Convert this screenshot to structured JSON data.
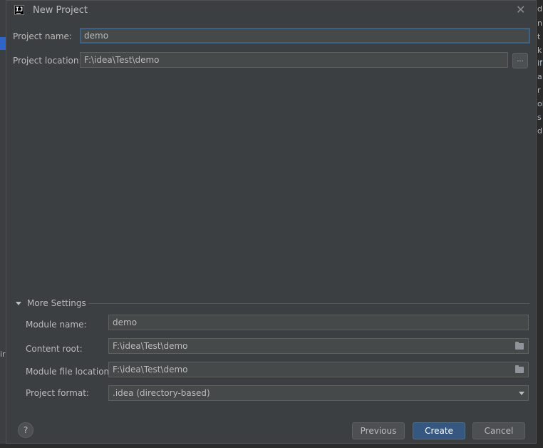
{
  "background": {
    "right_fragments": [
      "d",
      "n",
      "t",
      "k",
      "if",
      "a",
      "r",
      "ol",
      "s",
      "d"
    ],
    "left_fragment": "ir"
  },
  "dialog": {
    "title": "New Project",
    "close_symbol": "✕",
    "project_name": {
      "label": "Project name:",
      "value": "demo"
    },
    "project_location": {
      "label": "Project location:",
      "value": "F:\\idea\\Test\\demo",
      "browse_label": "..."
    },
    "more_settings": {
      "label": "More Settings",
      "expanded": true,
      "module_name": {
        "label": "Module name:",
        "value": "demo"
      },
      "content_root": {
        "label": "Content root:",
        "value": "F:\\idea\\Test\\demo"
      },
      "module_file_location": {
        "label": "Module file location:",
        "value": "F:\\idea\\Test\\demo"
      },
      "project_format": {
        "label": "Project format:",
        "value": ".idea (directory-based)"
      }
    },
    "buttons": {
      "help": "?",
      "previous": "Previous",
      "create": "Create",
      "cancel": "Cancel"
    }
  },
  "colors": {
    "dialog_bg": "#3c3f41",
    "field_bg": "#45494a",
    "focus_border": "#3d6185",
    "default_button": "#365880"
  }
}
